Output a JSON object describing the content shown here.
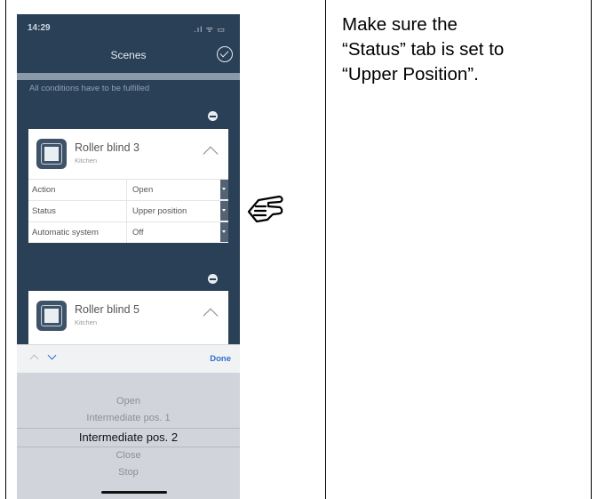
{
  "phone": {
    "status_time": "14:29",
    "status_icons": ".ıl ᯤ ▭",
    "nav_title": "Scenes",
    "conditions_text": "All conditions have to be fulfilled",
    "devices": [
      {
        "name": "Roller blind 3",
        "room": "Kitchen",
        "rows": [
          {
            "label": "Action",
            "value": "Open"
          },
          {
            "label": "Status",
            "value": "Upper position"
          },
          {
            "label": "Automatic system",
            "value": "Off"
          }
        ]
      },
      {
        "name": "Roller blind 5",
        "room": "Kitchen"
      }
    ],
    "toolbar": {
      "done_label": "Done"
    },
    "picker_options": [
      "Open",
      "Intermediate pos. 1",
      "Intermediate pos. 2",
      "Close",
      "Stop"
    ],
    "picker_selected_index": 2
  },
  "instruction": "Make sure the\n“Status” tab is set to\n“Upper Position”."
}
